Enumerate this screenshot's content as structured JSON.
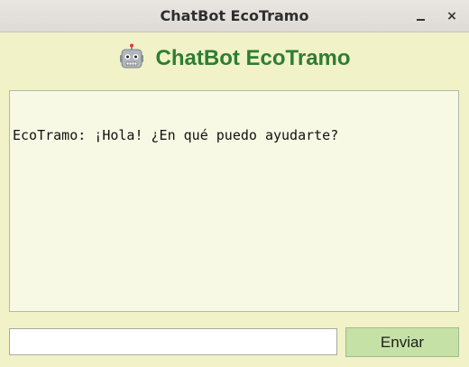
{
  "window": {
    "title": "ChatBot EcoTramo",
    "minimize_label": "_",
    "close_label": "×"
  },
  "header": {
    "icon": "robot-icon",
    "title": "ChatBot EcoTramo",
    "title_color": "#2e7d32"
  },
  "chat": {
    "messages": [
      {
        "sender": "EcoTramo",
        "text": "EcoTramo: ¡Hola! ¿En qué puedo ayudarte?"
      }
    ]
  },
  "input": {
    "value": "",
    "placeholder": ""
  },
  "send_button": {
    "label": "Enviar",
    "color": "#c5e1a5"
  },
  "colors": {
    "background": "#f1f2c7",
    "chat_background": "#f8f9e5"
  }
}
